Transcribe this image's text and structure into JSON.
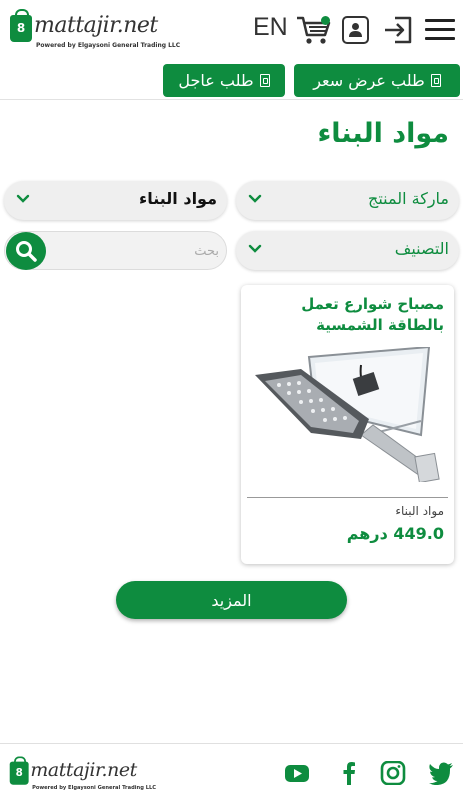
{
  "header": {
    "logo_text": "mattajir.net",
    "logo_tagline": "Powered by Elgaysoni General Trading LLC",
    "logo_bag_mark": "8",
    "language_toggle": "EN",
    "icons": [
      "cart-icon",
      "user-icon",
      "login-icon",
      "menu-icon"
    ],
    "request_quote_label": "طلب عرض سعر",
    "urgent_request_label": "طلب عاجل"
  },
  "page": {
    "title": "مواد البناء"
  },
  "filters": {
    "brand_select": "ماركة المنتج",
    "category_select": "مواد البناء",
    "classification_select": "التصنيف",
    "search_placeholder": "بحث",
    "search_value": ""
  },
  "products": [
    {
      "title": "مصباح شوارع تعمل بالطاقة الشمسية",
      "category": "مواد البناء",
      "price": "449.0 درهم"
    }
  ],
  "load_more_label": "المزيد",
  "footer": {
    "logo_text": "mattajir.net",
    "logo_tagline": "Powered by Elgaysoni General Trading LLC",
    "social": [
      "youtube-icon",
      "facebook-icon",
      "instagram-icon",
      "twitter-icon"
    ]
  },
  "colors": {
    "brand_green": "#0e8c3f",
    "select_bg": "#efefef"
  }
}
